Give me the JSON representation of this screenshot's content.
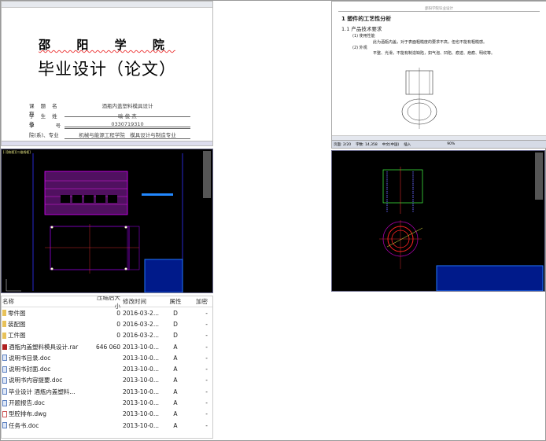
{
  "cover": {
    "school": "邵 阳 学 院",
    "title": "毕业设计（论文）",
    "fields": [
      {
        "label": "课 题 名 称",
        "value": "酒瓶内盖塑料模具设计"
      },
      {
        "label": "学 生 姓 名",
        "value": "喻 俊 杰"
      },
      {
        "label": "学　　 号",
        "value": "0330719310"
      },
      {
        "label": "院(系)、专业",
        "value": "机械与能源工程学院　模具设计与制造专业"
      }
    ]
  },
  "doc2": {
    "header": "邵阳学院毕业设计",
    "h1": "1  塑件的工艺性分析",
    "h2": "1.1  产品技术要求",
    "p1": "(1)  使用性能",
    "p1text": "此为酒瓶内盖，对于表面粗糙度的要求不高，但也不能有粗糙感。",
    "p2": "(2)  外观",
    "p2text": "平整、光滑，不能有制造缺陷，如气泡、凹陷、痕迹、疤痕、明纹等。",
    "status": {
      "page": "页面: 2/20",
      "words": "字数: 14,358",
      "lang": "中文(中国)",
      "mode": "插入",
      "zoom": "90%"
    }
  },
  "cad1": {
    "title": "[-][俯视][二维线框]"
  },
  "files": {
    "columns": [
      "名称",
      "压缩后大小",
      "修改时间",
      "属性",
      "加密"
    ],
    "rows": [
      {
        "icon": "folder",
        "name": "零件图",
        "size": "0",
        "date": "2016-03-2...",
        "attr": "D",
        "enc": "-"
      },
      {
        "icon": "folder",
        "name": "装配图",
        "size": "0",
        "date": "2016-03-2...",
        "attr": "D",
        "enc": "-"
      },
      {
        "icon": "folder",
        "name": "工件图",
        "size": "0",
        "date": "2016-03-2...",
        "attr": "D",
        "enc": "-"
      },
      {
        "icon": "rar",
        "name": "酒瓶内盖塑料模具设计.rar",
        "size": "646 060",
        "date": "2013-10-0...",
        "attr": "A",
        "enc": "-"
      },
      {
        "icon": "doc",
        "name": "说明书目录.doc",
        "size": "",
        "date": "2013-10-0...",
        "attr": "A",
        "enc": "-"
      },
      {
        "icon": "doc",
        "name": "说明书封面.doc",
        "size": "",
        "date": "2013-10-0...",
        "attr": "A",
        "enc": "-"
      },
      {
        "icon": "doc",
        "name": "说明书内容提要.doc",
        "size": "",
        "date": "2013-10-0...",
        "attr": "A",
        "enc": "-"
      },
      {
        "icon": "doc",
        "name": "毕业设计 酒瓶内盖塑料...",
        "size": "",
        "date": "2013-10-0...",
        "attr": "A",
        "enc": "-"
      },
      {
        "icon": "doc",
        "name": "开题报告.doc",
        "size": "",
        "date": "2013-10-0...",
        "attr": "A",
        "enc": "-"
      },
      {
        "icon": "dwg",
        "name": "型腔排布.dwg",
        "size": "",
        "date": "2013-10-0...",
        "attr": "A",
        "enc": "-"
      },
      {
        "icon": "doc",
        "name": "任务书.doc",
        "size": "",
        "date": "2013-10-0...",
        "attr": "A",
        "enc": "-"
      }
    ]
  }
}
